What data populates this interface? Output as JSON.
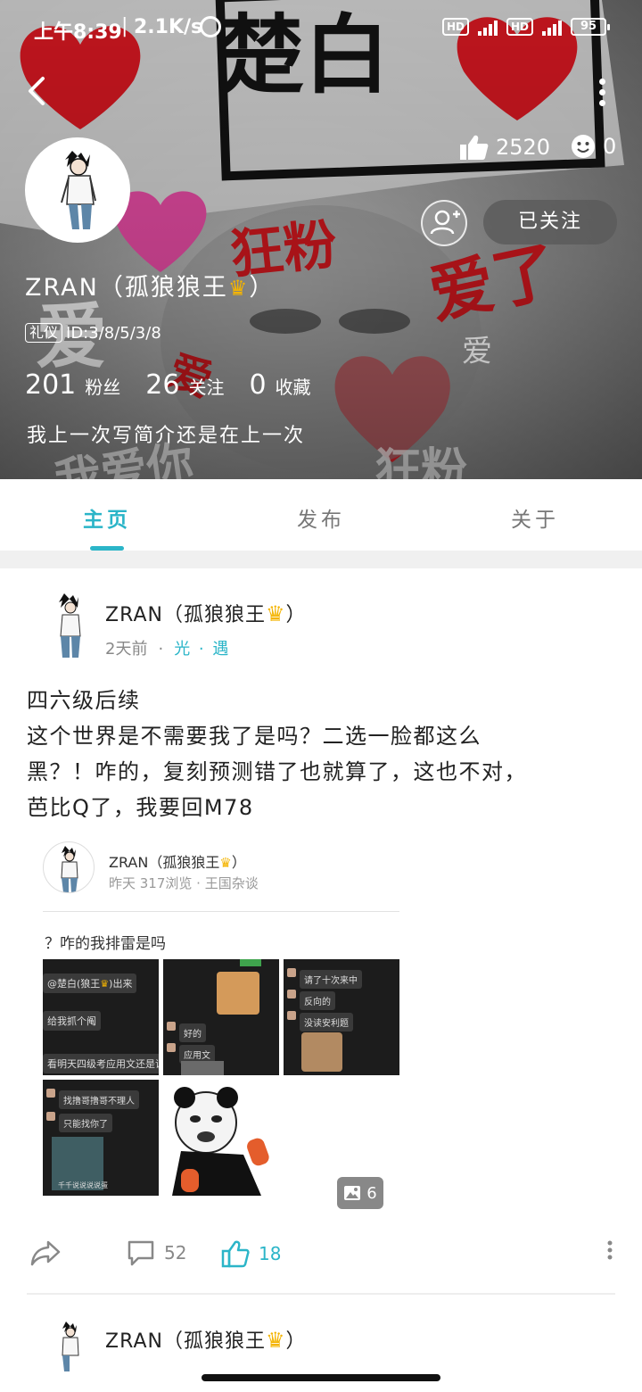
{
  "status_bar": {
    "time": "上午8:39",
    "net_speed": "2.1K/s",
    "hd1": "HD",
    "hd2": "HD",
    "battery": "95"
  },
  "cover": {
    "banner_text": "楚白",
    "sticker_words": [
      "狂粉",
      "爱了",
      "爱",
      "爱",
      "我爱你",
      "狂粉",
      "爱"
    ]
  },
  "profile": {
    "likes": "2520",
    "smiles": "0",
    "follow_label": "已关注",
    "nickname": "ZRAN（孤狼狼王",
    "nickname_end": "）",
    "id_tag": "礼仪",
    "id_text": "ID:3/8/5/3/8",
    "fans_count": "201",
    "fans_label": "粉丝",
    "following_count": "26",
    "following_label": "关注",
    "favorites_count": "0",
    "favorites_label": "收藏",
    "bio": "我上一次写简介还是在上一次"
  },
  "tabs": [
    {
      "label": "主页",
      "active": true
    },
    {
      "label": "发布",
      "active": false
    },
    {
      "label": "关于",
      "active": false
    }
  ],
  "post": {
    "author": "ZRAN（孤狼狼王",
    "author_end": "）",
    "time": "2天前",
    "topic": "光 · 遇",
    "body_lines": [
      "四六级后续",
      "这个世界是不需要我了是吗？二选一脸都这么",
      "黑？！咋的，复刻预测错了也就算了，这也不对，",
      "芭比Q了，我要回M78"
    ],
    "quoted": {
      "author": "ZRAN（孤狼狼王",
      "author_end": "）",
      "meta": "昨天 317浏览 · 王国杂谈",
      "text": "？咋的我排雷是吗",
      "image_count": "6",
      "thumb1_lines": [
        "@楚白(狼王",
        ")出来",
        "给我抓个阄",
        "看明天四级考应用文还是议"
      ],
      "thumb2_lines": [
        "好的",
        "应用文"
      ],
      "thumb3_lines": [
        "请了十次来中",
        "反向的",
        "没读安利题"
      ],
      "thumb4_lines": [
        "找撸哥撸哥不理人",
        "只能找你了",
        "千千说说说说蛋"
      ]
    },
    "comments": "52",
    "likes": "18"
  },
  "post2": {
    "author": "ZRAN（孤狼狼王",
    "author_end": "）"
  },
  "colors": {
    "accent": "#2bb5c8",
    "heart_red": "#d8202a",
    "crown_gold": "#f4b400"
  }
}
